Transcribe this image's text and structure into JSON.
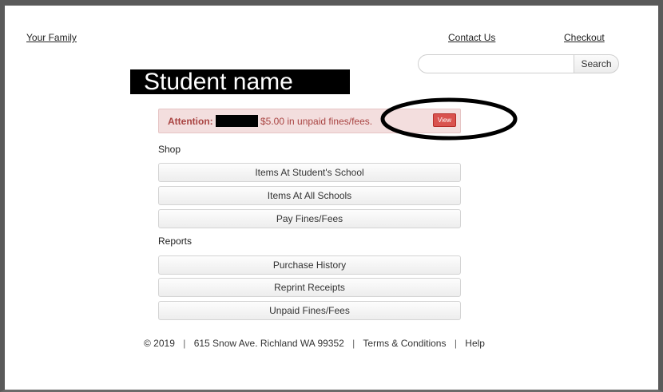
{
  "header": {
    "your_family": "Your Family",
    "contact_us": "Contact Us",
    "checkout": "Checkout"
  },
  "search": {
    "value": "",
    "placeholder": "",
    "button_label": "Search"
  },
  "student_name_label": "Student name",
  "alert": {
    "label": "Attention:",
    "message": "$5.00 in unpaid fines/fees.",
    "view_label": "View",
    "color": "#d9534f"
  },
  "shop": {
    "heading": "Shop",
    "items": [
      {
        "label": "Items At Student's School"
      },
      {
        "label": "Items At All Schools"
      },
      {
        "label": "Pay Fines/Fees"
      }
    ]
  },
  "reports": {
    "heading": "Reports",
    "items": [
      {
        "label": "Purchase History"
      },
      {
        "label": "Reprint Receipts"
      },
      {
        "label": "Unpaid Fines/Fees"
      }
    ]
  },
  "footer": {
    "copyright": "© 2019",
    "address": "615 Snow Ave. Richland WA 99352",
    "terms": "Terms & Conditions",
    "help": "Help",
    "separator": "|"
  }
}
